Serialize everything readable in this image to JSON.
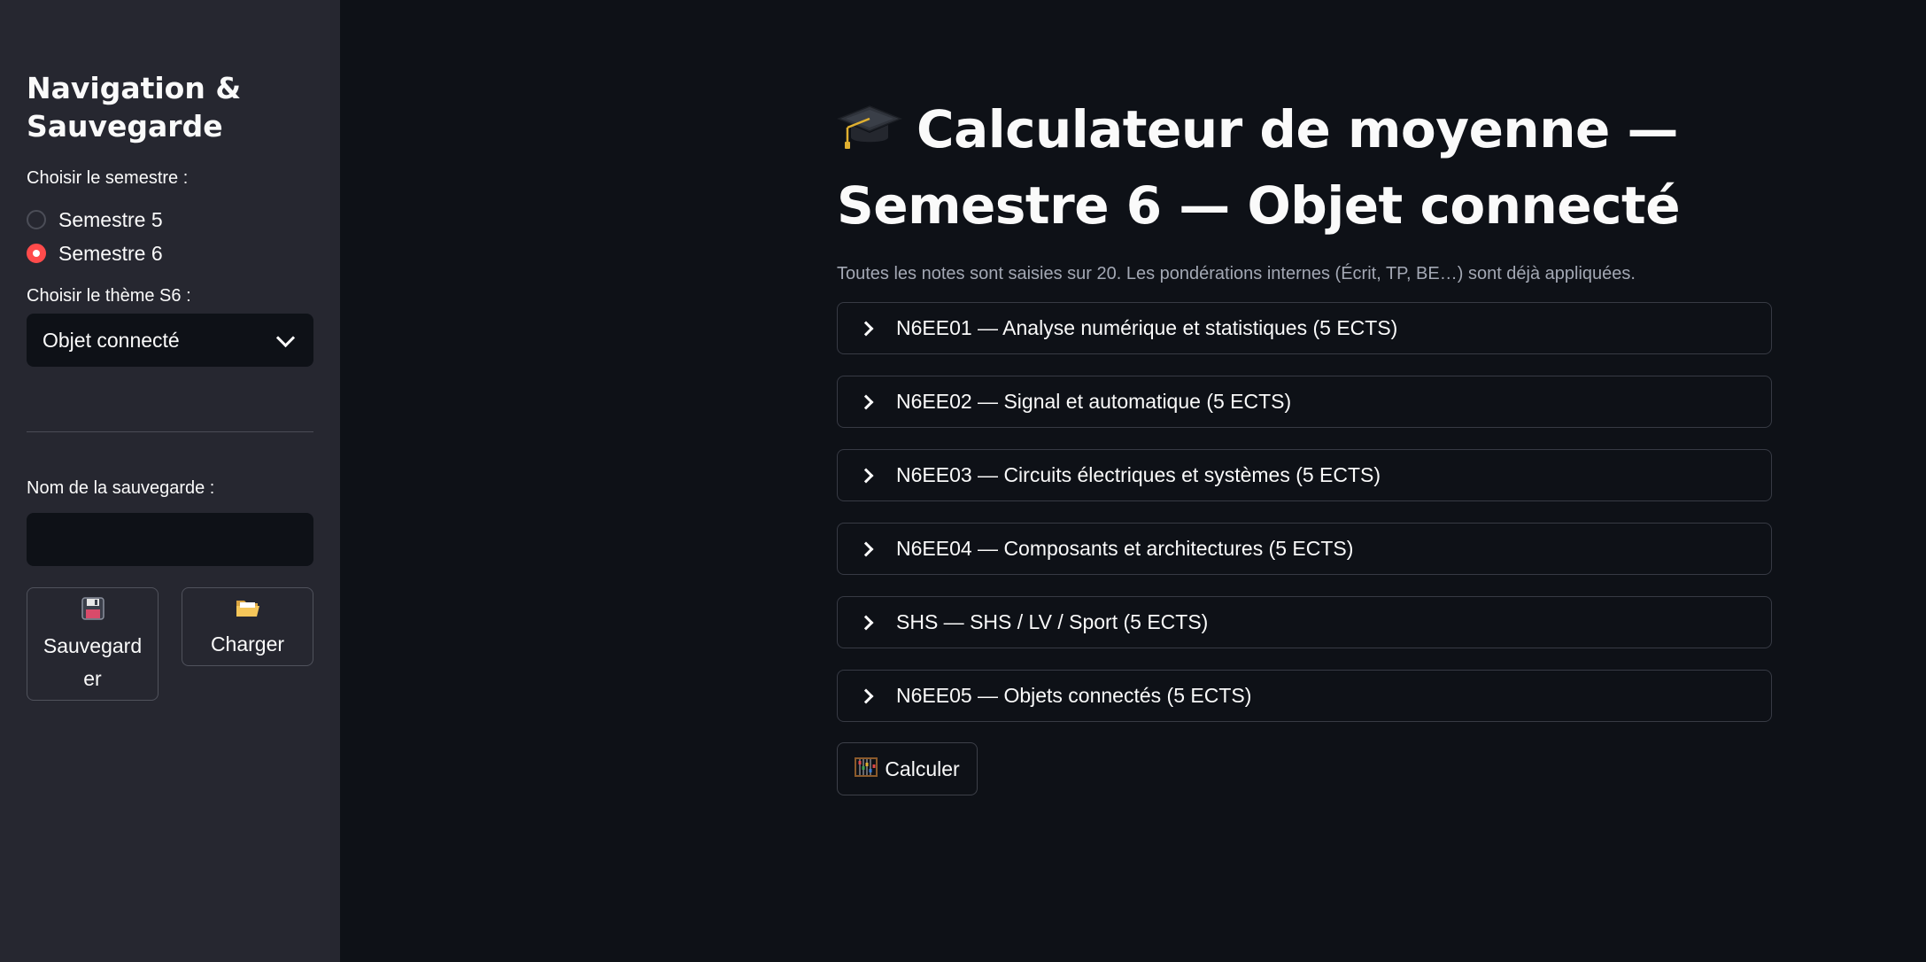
{
  "sidebar": {
    "title": "Navigation & Sauvegarde",
    "semester_label": "Choisir le semestre :",
    "semester_options": [
      {
        "label": "Semestre 5",
        "checked": false
      },
      {
        "label": "Semestre 6",
        "checked": true
      }
    ],
    "theme_label": "Choisir le thème S6 :",
    "theme_value": "Objet connecté",
    "save_name_label": "Nom de la sauvegarde :",
    "save_name_value": "",
    "save_button": {
      "icon": "floppy-disk-icon",
      "label": "Sauvegarder"
    },
    "load_button": {
      "icon": "open-folder-icon",
      "label": "Charger"
    }
  },
  "main": {
    "title_icon": "graduation-cap-icon",
    "title_line1": "Calculateur de moyenne —",
    "title_line2": "Semestre 6 — Objet connecté",
    "caption": "Toutes les notes sont saisies sur 20. Les pondérations internes (Écrit, TP, BE…) sont déjà appliquées.",
    "expanders": [
      {
        "label": "N6EE01 — Analyse numérique et statistiques (5 ECTS)"
      },
      {
        "label": "N6EE02 — Signal et automatique (5 ECTS)"
      },
      {
        "label": "N6EE03 — Circuits électriques et systèmes (5 ECTS)"
      },
      {
        "label": "N6EE04 — Composants et architectures (5 ECTS)"
      },
      {
        "label": "SHS — SHS / LV / Sport (5 ECTS)"
      },
      {
        "label": "N6EE05 — Objets connectés (5 ECTS)"
      }
    ],
    "calc_button": {
      "icon": "abacus-icon",
      "label": "Calculer"
    }
  },
  "colors": {
    "background": "#0e1117",
    "sidebar": "#262730",
    "accent": "#ff4b4b",
    "text": "#fafafa",
    "caption": "#a3a8b4"
  }
}
